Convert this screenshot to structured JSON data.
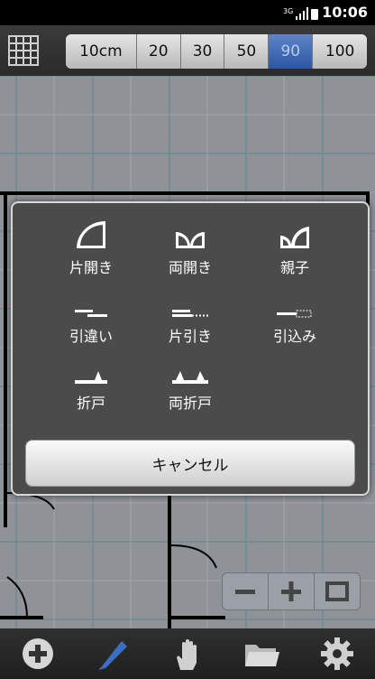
{
  "status": {
    "network": "3G",
    "time": "10:06"
  },
  "scale": {
    "options": [
      "10cm",
      "20",
      "30",
      "50",
      "90",
      "100"
    ],
    "selected": "90"
  },
  "dialog": {
    "options": [
      {
        "label": "片開き",
        "icon": "single-door-icon"
      },
      {
        "label": "両開き",
        "icon": "double-door-icon"
      },
      {
        "label": "親子",
        "icon": "parent-child-door-icon"
      },
      {
        "label": "引違い",
        "icon": "sliding-door-icon"
      },
      {
        "label": "片引き",
        "icon": "single-sliding-door-icon"
      },
      {
        "label": "引込み",
        "icon": "pocket-door-icon"
      },
      {
        "label": "折戸",
        "icon": "folding-door-icon"
      },
      {
        "label": "両折戸",
        "icon": "double-folding-door-icon"
      }
    ],
    "cancel_label": "キャンセル"
  },
  "bottom": {
    "icons": [
      "add-icon",
      "pencil-icon",
      "hand-icon",
      "folder-icon",
      "gear-icon"
    ]
  },
  "zoom": {
    "icons": [
      "zoom-out-icon",
      "zoom-in-icon",
      "fit-icon"
    ]
  }
}
